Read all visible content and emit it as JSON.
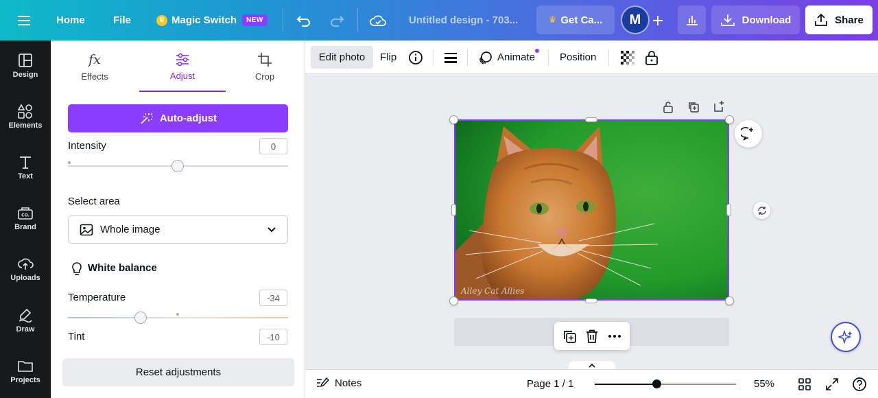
{
  "topbar": {
    "home": "Home",
    "file": "File",
    "magic_switch": "Magic Switch",
    "new_badge": "NEW",
    "doc_title": "Untitled design - 703...",
    "get_canva": "Get Ca...",
    "avatar_initial": "M",
    "download": "Download",
    "share": "Share"
  },
  "rail": [
    {
      "label": "Design"
    },
    {
      "label": "Elements"
    },
    {
      "label": "Text"
    },
    {
      "label": "Brand"
    },
    {
      "label": "Uploads"
    },
    {
      "label": "Draw"
    },
    {
      "label": "Projects"
    }
  ],
  "panel": {
    "tabs": [
      {
        "label": "Effects"
      },
      {
        "label": "Adjust"
      },
      {
        "label": "Crop"
      }
    ],
    "auto_adjust": "Auto-adjust",
    "intensity": {
      "label": "Intensity",
      "value": "0"
    },
    "select_area": {
      "label": "Select area",
      "value": "Whole image"
    },
    "white_balance": "White balance",
    "temperature": {
      "label": "Temperature",
      "value": "-34"
    },
    "tint": {
      "label": "Tint",
      "value": "-10"
    },
    "reset": "Reset adjustments"
  },
  "ctx_toolbar": {
    "edit_photo": "Edit photo",
    "flip": "Flip",
    "animate": "Animate",
    "position": "Position"
  },
  "canvas": {
    "watermark": "Alley Cat Allies"
  },
  "bottombar": {
    "notes": "Notes",
    "page": "Page 1 / 1",
    "zoom": "55%"
  },
  "colors": {
    "accent": "#8b3dff",
    "rail_bg": "#18191b"
  }
}
